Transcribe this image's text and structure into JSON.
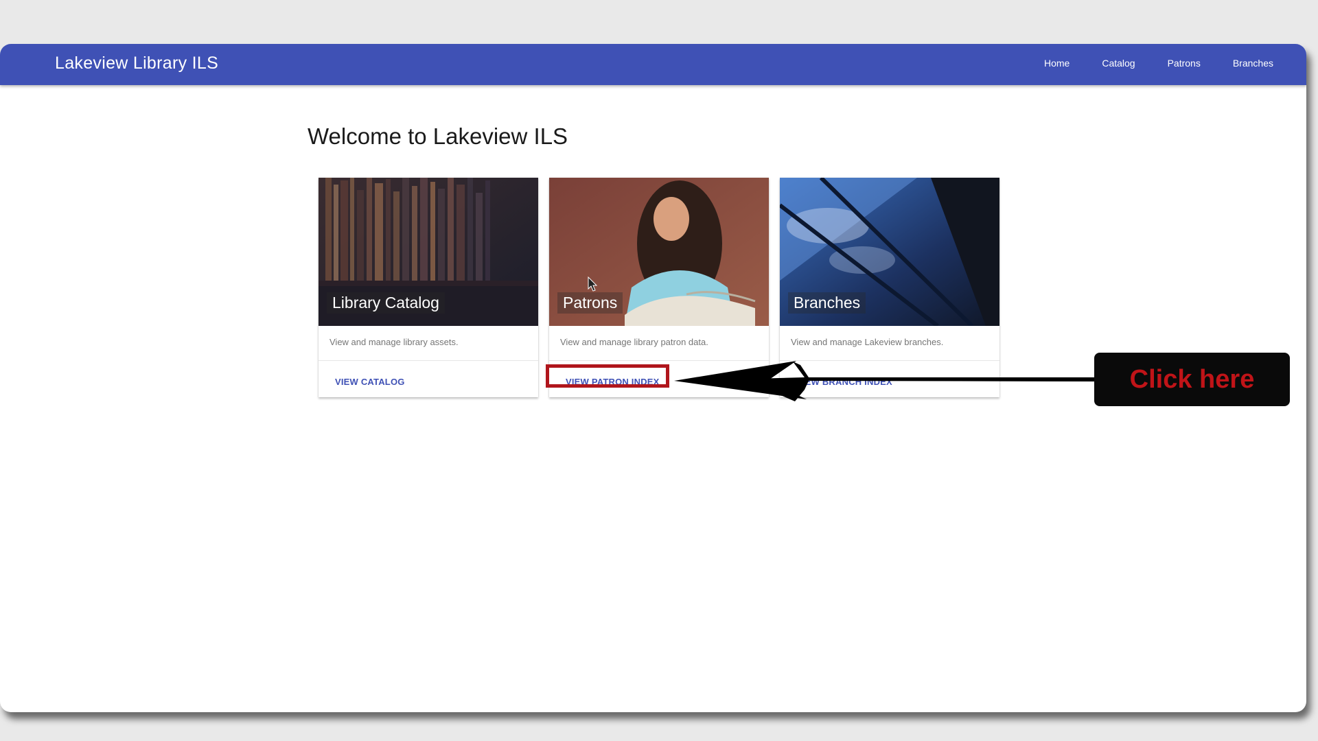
{
  "app": {
    "title": "Lakeview Library ILS"
  },
  "nav": {
    "items": [
      {
        "label": "Home"
      },
      {
        "label": "Catalog"
      },
      {
        "label": "Patrons"
      },
      {
        "label": "Branches"
      }
    ]
  },
  "main": {
    "title": "Welcome to Lakeview ILS",
    "cards": [
      {
        "title": "Library Catalog",
        "description": "View and manage library assets.",
        "action": "VIEW CATALOG"
      },
      {
        "title": "Patrons",
        "description": "View and manage library patron data.",
        "action": "VIEW PATRON INDEX"
      },
      {
        "title": "Branches",
        "description": "View and manage Lakeview branches.",
        "action": "VIEW BRANCH INDEX"
      }
    ]
  },
  "annotation": {
    "callout": "Click here"
  },
  "colors": {
    "navbar": "#3f51b5",
    "accent": "#3f51b5",
    "highlight": "#b0161c",
    "callout_text": "#c01418"
  },
  "icons": {
    "cursor": "mouse-cursor-icon",
    "arrow": "pointer-arrow-icon"
  }
}
